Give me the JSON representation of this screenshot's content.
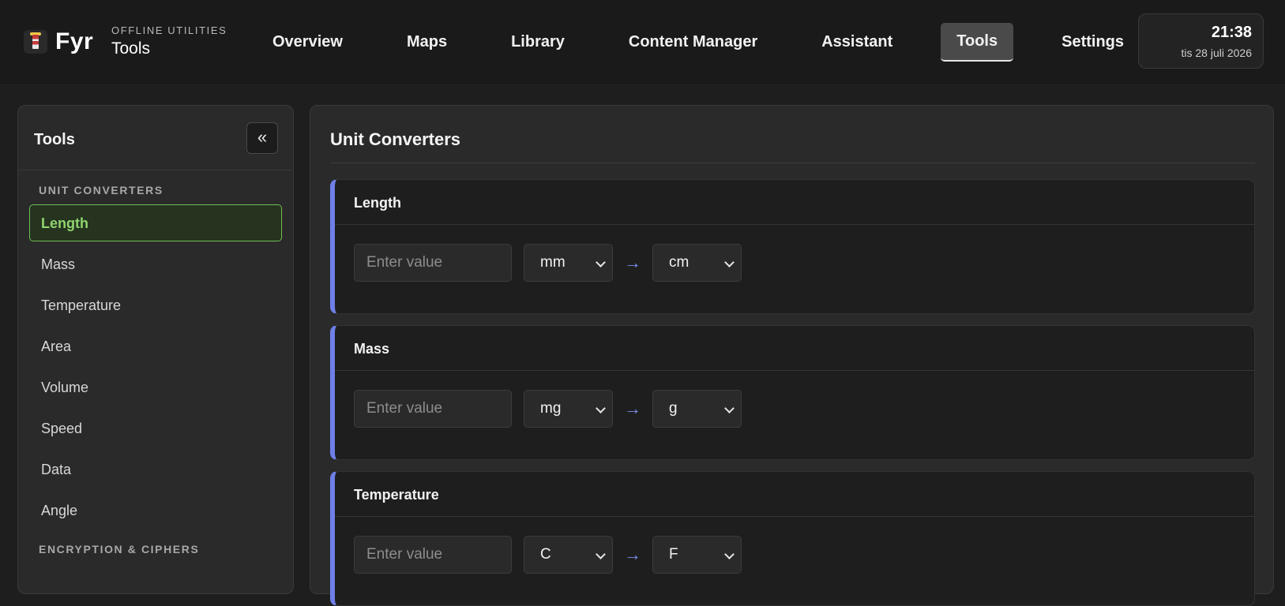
{
  "app": {
    "name": "Fyr",
    "eyebrow": "OFFLINE UTILITIES",
    "page_title": "Tools"
  },
  "nav": {
    "items": [
      {
        "label": "Overview"
      },
      {
        "label": "Maps"
      },
      {
        "label": "Library"
      },
      {
        "label": "Content Manager"
      },
      {
        "label": "Assistant"
      },
      {
        "label": "Tools",
        "active": true
      },
      {
        "label": "Settings"
      }
    ]
  },
  "clock": {
    "time": "21:38",
    "date": "tis 28 juli 2026"
  },
  "sidebar": {
    "title": "Tools",
    "collapse_label": "«",
    "sections": [
      {
        "label": "UNIT CONVERTERS",
        "items": [
          {
            "label": "Length",
            "active": true
          },
          {
            "label": "Mass"
          },
          {
            "label": "Temperature"
          },
          {
            "label": "Area"
          },
          {
            "label": "Volume"
          },
          {
            "label": "Speed"
          },
          {
            "label": "Data"
          },
          {
            "label": "Angle"
          }
        ]
      },
      {
        "label": "ENCRYPTION & CIPHERS",
        "items": []
      }
    ]
  },
  "main": {
    "title": "Unit Converters",
    "converters": [
      {
        "title": "Length",
        "placeholder": "Enter value",
        "from": "mm",
        "to": "cm",
        "arrow": "→"
      },
      {
        "title": "Mass",
        "placeholder": "Enter value",
        "from": "mg",
        "to": "g",
        "arrow": "→"
      },
      {
        "title": "Temperature",
        "placeholder": "Enter value",
        "from": "C",
        "to": "F",
        "arrow": "→"
      }
    ]
  },
  "colors": {
    "accent_blue": "#6f7fe8",
    "active_green": "#8fd46e",
    "background": "#1e1e1e",
    "panel": "#2a2a2a"
  }
}
